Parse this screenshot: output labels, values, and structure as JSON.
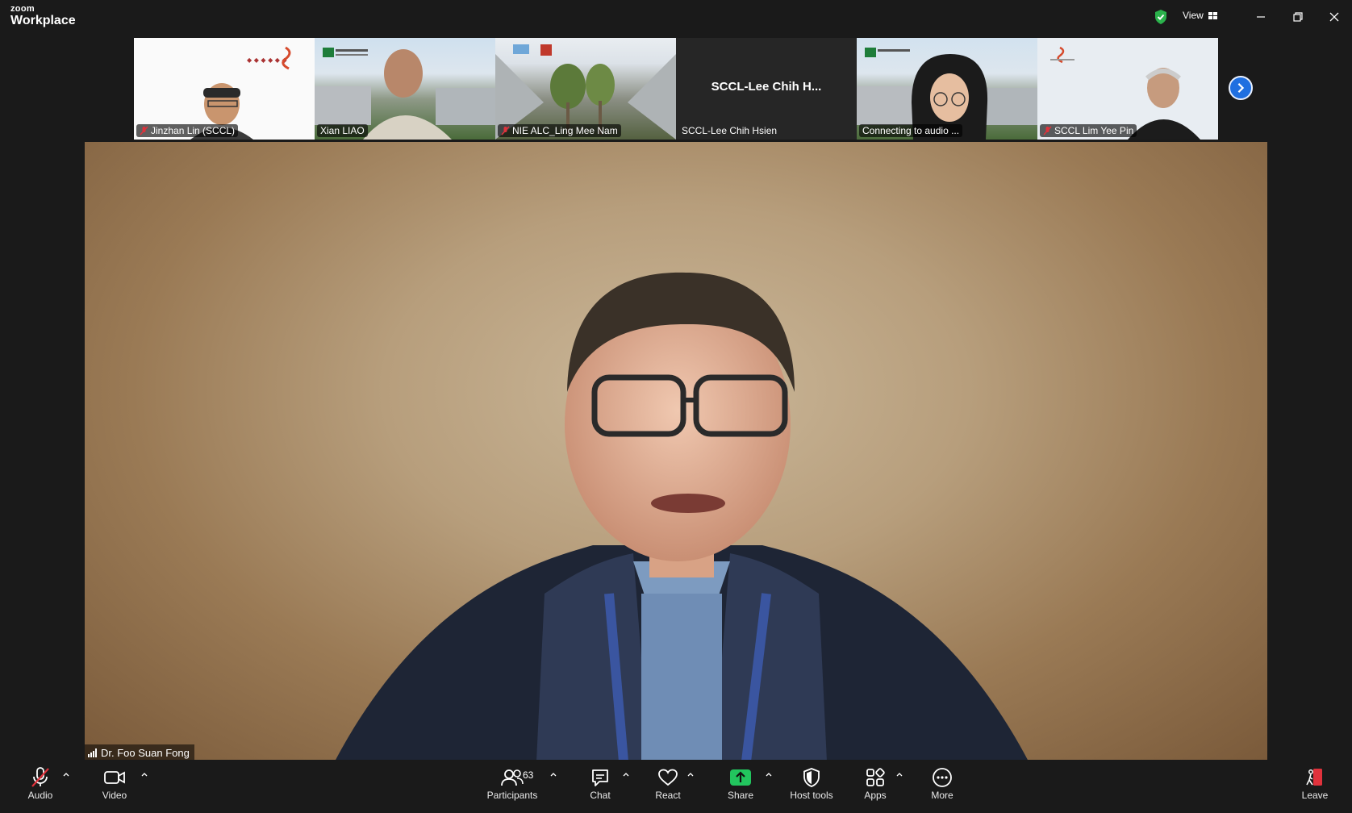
{
  "app": {
    "brand_small": "zoom",
    "brand_large": "Workplace"
  },
  "titlebar": {
    "view_label": "View"
  },
  "thumbnails": [
    {
      "name": "Jinzhan Lin (SCCL)",
      "muted": true
    },
    {
      "name": "Xian LIAO",
      "muted": false
    },
    {
      "name": "NIE ALC_Ling Mee Nam",
      "muted": true
    },
    {
      "name": "SCCL-Lee Chih Hsien",
      "muted": false,
      "display_title": "SCCL-Lee  Chih  H..."
    },
    {
      "name": "Connecting to audio ...",
      "muted": false
    },
    {
      "name": "SCCL Lim Yee Pin",
      "muted": true
    }
  ],
  "main_video": {
    "speaker_name": "Dr. Foo Suan Fong"
  },
  "toolbar": {
    "audio": "Audio",
    "video": "Video",
    "participants": "Participants",
    "participants_count": "63",
    "chat": "Chat",
    "react": "React",
    "share": "Share",
    "host_tools": "Host tools",
    "apps": "Apps",
    "more": "More",
    "leave": "Leave"
  },
  "colors": {
    "share_green": "#22c55e",
    "leave_red": "#e0323c",
    "accent_blue": "#1f6fe0",
    "shield_green": "#2bb24c"
  },
  "icons": [
    "shield-check-icon",
    "grid-icon",
    "minimize-icon",
    "restore-icon",
    "close-icon",
    "mic-off-icon",
    "camera-icon",
    "participants-icon",
    "chat-icon",
    "heart-icon",
    "share-arrow-icon",
    "shield-icon",
    "apps-icon",
    "more-icon",
    "leave-door-icon",
    "chevron-right-icon",
    "signal-icon"
  ]
}
